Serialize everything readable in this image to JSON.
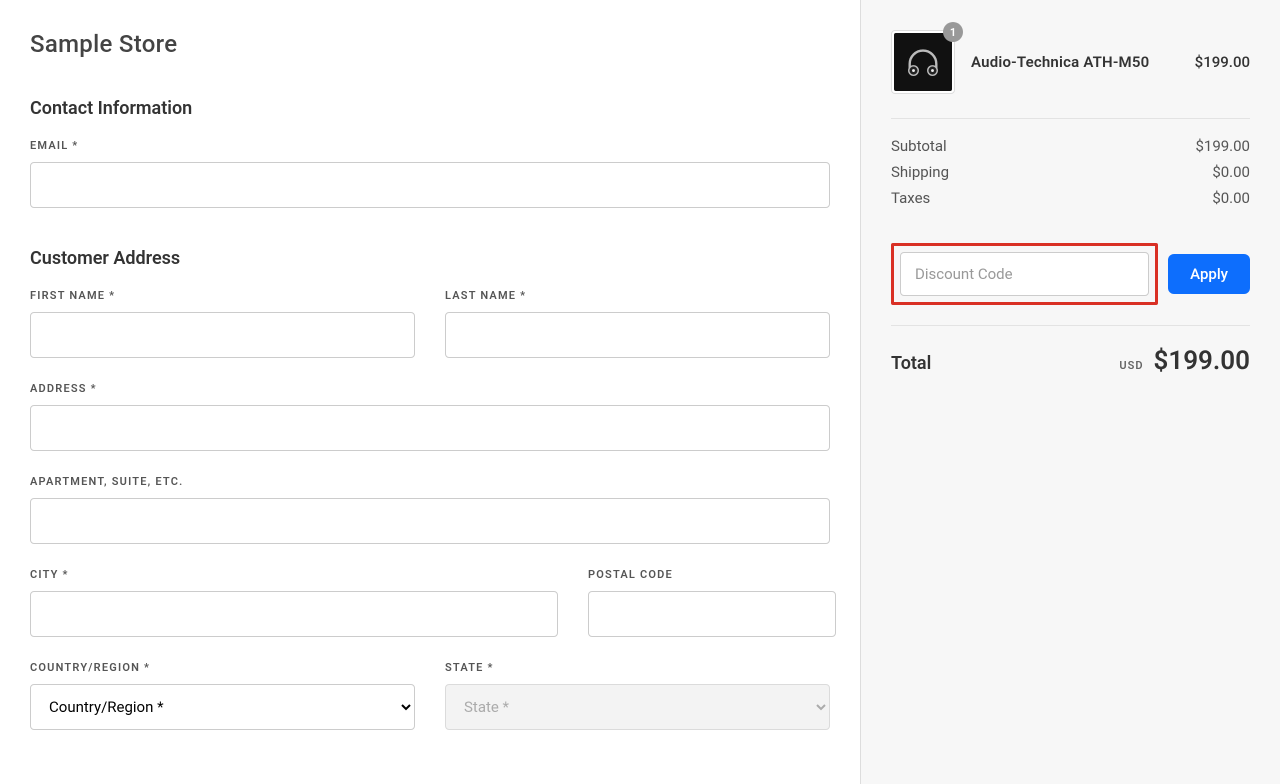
{
  "store": {
    "title": "Sample Store"
  },
  "sections": {
    "contact": "Contact Information",
    "address": "Customer Address"
  },
  "labels": {
    "email": "EMAIL *",
    "first_name": "FIRST NAME *",
    "last_name": "LAST NAME *",
    "address": "ADDRESS *",
    "apartment": "APARTMENT, SUITE, ETC.",
    "city": "CITY *",
    "postal": "POSTAL CODE",
    "country": "COUNTRY/REGION *",
    "state": "STATE *"
  },
  "placeholders": {
    "country": "Country/Region *",
    "state": "State *",
    "discount": "Discount Code"
  },
  "cart": {
    "items": [
      {
        "name": "Audio-Technica ATH-M50",
        "price": "$199.00",
        "qty": "1"
      }
    ],
    "subtotal_label": "Subtotal",
    "subtotal_value": "$199.00",
    "shipping_label": "Shipping",
    "shipping_value": "$0.00",
    "taxes_label": "Taxes",
    "taxes_value": "$0.00",
    "apply_label": "Apply",
    "total_label": "Total",
    "total_currency": "USD",
    "total_amount": "$199.00"
  }
}
